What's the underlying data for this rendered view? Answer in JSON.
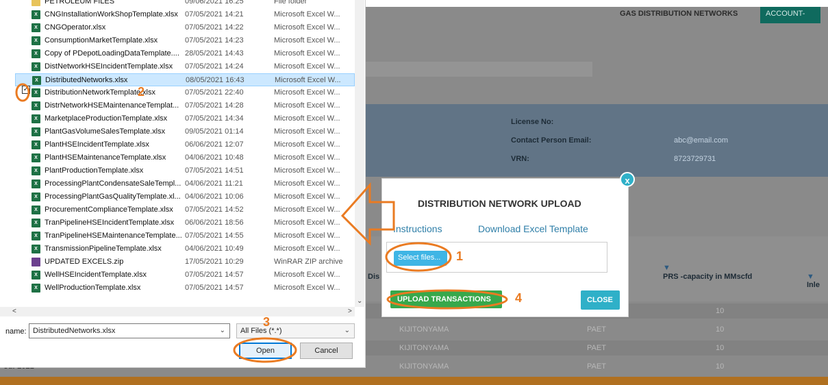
{
  "app": {
    "title": "GAS DISTRIBUTION NETWORKS",
    "account_button": "ACCOUNT-",
    "info": [
      {
        "label": "License No:",
        "value": ""
      },
      {
        "label": "Contact Person Email:",
        "value": "abc@email.com"
      },
      {
        "label": "VRN:",
        "value": "8723729731"
      }
    ],
    "table_headers": [
      "Dis",
      "PRS -capacity in MMscfd",
      "Inle"
    ],
    "rows": [
      {
        "date": "",
        "name": "",
        "code": "",
        "value": "10"
      },
      {
        "date": "",
        "name": "KIJITONYAMA",
        "code": "PAET",
        "value": "10"
      },
      {
        "date": "",
        "name": "KIJITONYAMA",
        "code": "PAET",
        "value": "10"
      },
      {
        "date": "-Jul-2021",
        "name": "KIJITONYAMA",
        "code": "PAET",
        "value": "10"
      }
    ]
  },
  "modal": {
    "close_x": "x",
    "title": "DISTRIBUTION NETWORK UPLOAD",
    "instructions_link": "Instructions",
    "download_link": "Download Excel Template",
    "select_files": "Select files...",
    "upload_button": "UPLOAD TRANSACTIONS",
    "close_button": "CLOSE"
  },
  "dialog": {
    "files": [
      {
        "name": "PETROLEUM FILES",
        "date": "09/06/2021 16:25",
        "type": "File folder",
        "kind": "folder"
      },
      {
        "name": "CNGInstallationWorkShopTemplate.xlsx",
        "date": "07/05/2021 14:21",
        "type": "Microsoft Excel W...",
        "kind": "xlsx"
      },
      {
        "name": "CNGOperator.xlsx",
        "date": "07/05/2021 14:22",
        "type": "Microsoft Excel W...",
        "kind": "xlsx"
      },
      {
        "name": "ConsumptionMarketTemplate.xlsx",
        "date": "07/05/2021 14:23",
        "type": "Microsoft Excel W...",
        "kind": "xlsx"
      },
      {
        "name": "Copy of PDepotLoadingDataTemplate....",
        "date": "28/05/2021 14:43",
        "type": "Microsoft Excel W...",
        "kind": "xlsx"
      },
      {
        "name": "DistNetworkHSEIncidentTemplate.xlsx",
        "date": "07/05/2021 14:24",
        "type": "Microsoft Excel W...",
        "kind": "xlsx"
      },
      {
        "name": "DistributedNetworks.xlsx",
        "date": "08/05/2021 16:43",
        "type": "Microsoft Excel W...",
        "kind": "xlsx",
        "selected": true
      },
      {
        "name": "DistributionNetworkTemplate.xlsx",
        "date": "07/05/2021 22:40",
        "type": "Microsoft Excel W...",
        "kind": "xlsx"
      },
      {
        "name": "DistrNetworkHSEMaintenanceTemplat...",
        "date": "07/05/2021 14:28",
        "type": "Microsoft Excel W...",
        "kind": "xlsx"
      },
      {
        "name": "MarketplaceProductionTemplate.xlsx",
        "date": "07/05/2021 14:34",
        "type": "Microsoft Excel W...",
        "kind": "xlsx"
      },
      {
        "name": "PlantGasVolumeSalesTemplate.xlsx",
        "date": "09/05/2021 01:14",
        "type": "Microsoft Excel W...",
        "kind": "xlsx"
      },
      {
        "name": "PlantHSEIncidentTemplate.xlsx",
        "date": "06/06/2021 12:07",
        "type": "Microsoft Excel W...",
        "kind": "xlsx"
      },
      {
        "name": "PlantHSEMaintenanceTemplate.xlsx",
        "date": "04/06/2021 10:48",
        "type": "Microsoft Excel W...",
        "kind": "xlsx"
      },
      {
        "name": "PlantProductionTemplate.xlsx",
        "date": "07/05/2021 14:51",
        "type": "Microsoft Excel W...",
        "kind": "xlsx"
      },
      {
        "name": "ProcessingPlantCondensateSaleTempl...",
        "date": "04/06/2021 11:21",
        "type": "Microsoft Excel W...",
        "kind": "xlsx"
      },
      {
        "name": "ProcessingPlantGasQualityTemplate.xl...",
        "date": "04/06/2021 10:06",
        "type": "Microsoft Excel W...",
        "kind": "xlsx"
      },
      {
        "name": "ProcurementComplianceTemplate.xlsx",
        "date": "07/05/2021 14:52",
        "type": "Microsoft Excel W...",
        "kind": "xlsx"
      },
      {
        "name": "TranPipelineHSEIncidentTemplate.xlsx",
        "date": "06/06/2021 18:56",
        "type": "Microsoft Excel W...",
        "kind": "xlsx"
      },
      {
        "name": "TranPipelineHSEMaintenanceTemplate...",
        "date": "07/05/2021 14:55",
        "type": "Microsoft Excel W...",
        "kind": "xlsx"
      },
      {
        "name": "TransmissionPipelineTemplate.xlsx",
        "date": "04/06/2021 10:49",
        "type": "Microsoft Excel W...",
        "kind": "xlsx"
      },
      {
        "name": "UPDATED EXCELS.zip",
        "date": "17/05/2021 10:29",
        "type": "WinRAR ZIP archive",
        "kind": "zip"
      },
      {
        "name": "WellHSEIncidentTemplate.xlsx",
        "date": "07/05/2021 14:57",
        "type": "Microsoft Excel W...",
        "kind": "xlsx"
      },
      {
        "name": "WellProductionTemplate.xlsx",
        "date": "07/05/2021 14:57",
        "type": "Microsoft Excel W...",
        "kind": "xlsx"
      }
    ],
    "name_label": "name:",
    "file_name": "DistributedNetworks.xlsx",
    "filter": "All Files (*.*)",
    "open_button": "Open",
    "cancel_button": "Cancel"
  },
  "annotations": {
    "step1": "1",
    "step2": "2",
    "step3": "3",
    "step4": "4",
    "color": "#ea7b22"
  }
}
